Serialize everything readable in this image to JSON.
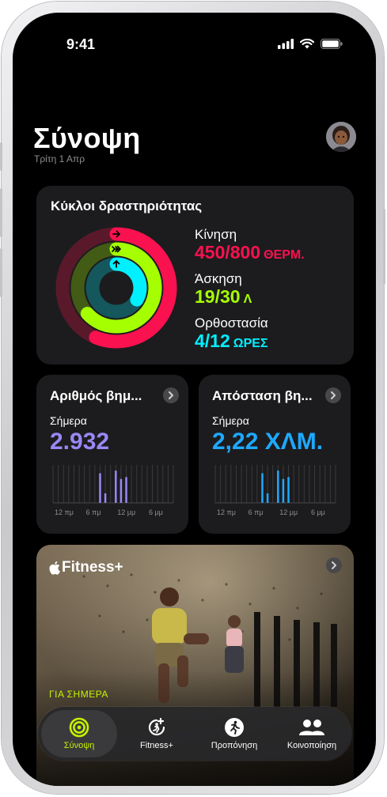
{
  "status_bar": {
    "time": "9:41"
  },
  "header": {
    "title": "Σύνοψη",
    "date": "Τρίτη 1 Απρ"
  },
  "activity": {
    "title": "Κύκλοι δραστηριότητας",
    "move": {
      "label": "Κίνηση",
      "value": "450/800",
      "unit": "ΘΕΡΜ.",
      "color": "#fa114f",
      "progress": 0.5625
    },
    "exercise": {
      "label": "Άσκηση",
      "value": "19/30",
      "unit": "Λ",
      "color": "#a6ff00",
      "progress": 0.6333
    },
    "stand": {
      "label": "Ορθοστασία",
      "value": "4/12",
      "unit": "ΩΡΕΣ",
      "color": "#00f0ff",
      "progress": 0.3333
    }
  },
  "steps": {
    "title": "Αριθμός βημ...",
    "today": "Σήμερα",
    "value": "2.932",
    "color": "#9b87f5",
    "axis": [
      "12 πμ",
      "6 πμ",
      "12 μμ",
      "6 μμ"
    ]
  },
  "distance": {
    "title": "Απόσταση βη...",
    "today": "Σήμερα",
    "value": "2,22 ΧΛΜ.",
    "color": "#1ea9ff",
    "axis": [
      "12 πμ",
      "6 πμ",
      "12 μμ",
      "6 μμ"
    ]
  },
  "fitness_plus": {
    "brand": "Fitness+",
    "for_today": "ΓΙΑ ΣΗΜΕΡΑ",
    "accent": "#c6f200"
  },
  "tabbar": {
    "items": [
      {
        "label": "Σύνοψη",
        "icon": "rings-icon",
        "active": true
      },
      {
        "label": "Fitness+",
        "icon": "fitness-plus-icon",
        "active": false
      },
      {
        "label": "Προπόνηση",
        "icon": "running-person-icon",
        "active": false
      },
      {
        "label": "Κοινοποίηση",
        "icon": "people-icon",
        "active": false
      }
    ]
  }
}
